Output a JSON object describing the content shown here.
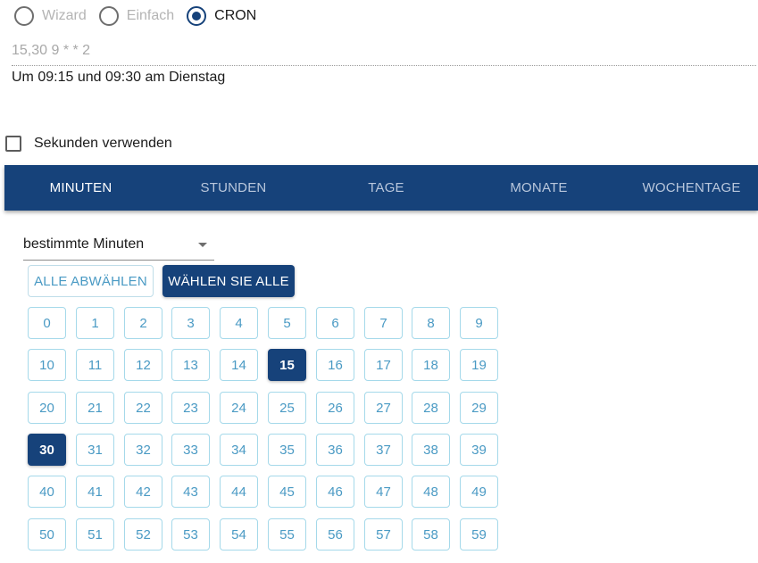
{
  "mode_options": [
    {
      "label": "Wizard",
      "checked": false
    },
    {
      "label": "Einfach",
      "checked": false
    },
    {
      "label": "CRON",
      "checked": true
    }
  ],
  "cron_expression": "15,30 9 * * 2",
  "cron_description": "Um 09:15 und 09:30 am Dienstag",
  "use_seconds": {
    "label": "Sekunden verwenden",
    "checked": false
  },
  "tabs": [
    {
      "label": "MINUTEN",
      "active": true
    },
    {
      "label": "STUNDEN",
      "active": false
    },
    {
      "label": "TAGE",
      "active": false
    },
    {
      "label": "MONATE",
      "active": false
    },
    {
      "label": "WOCHENTAGE",
      "active": false
    }
  ],
  "minute_mode_select": {
    "value": "bestimmte Minuten"
  },
  "deselect_all_label": "ALLE ABWÄHLEN",
  "select_all_label": "WÄHLEN SIE ALLE",
  "minutes": [
    "0",
    "1",
    "2",
    "3",
    "4",
    "5",
    "6",
    "7",
    "8",
    "9",
    "10",
    "11",
    "12",
    "13",
    "14",
    "15",
    "16",
    "17",
    "18",
    "19",
    "20",
    "21",
    "22",
    "23",
    "24",
    "25",
    "26",
    "27",
    "28",
    "29",
    "30",
    "31",
    "32",
    "33",
    "34",
    "35",
    "36",
    "37",
    "38",
    "39",
    "40",
    "41",
    "42",
    "43",
    "44",
    "45",
    "46",
    "47",
    "48",
    "49",
    "50",
    "51",
    "52",
    "53",
    "54",
    "55",
    "56",
    "57",
    "58",
    "59"
  ],
  "selected_minutes": [
    "15",
    "30"
  ],
  "colors": {
    "primary": "#16427a",
    "accent": "#4a9ac4",
    "border": "#a5d9ea"
  }
}
